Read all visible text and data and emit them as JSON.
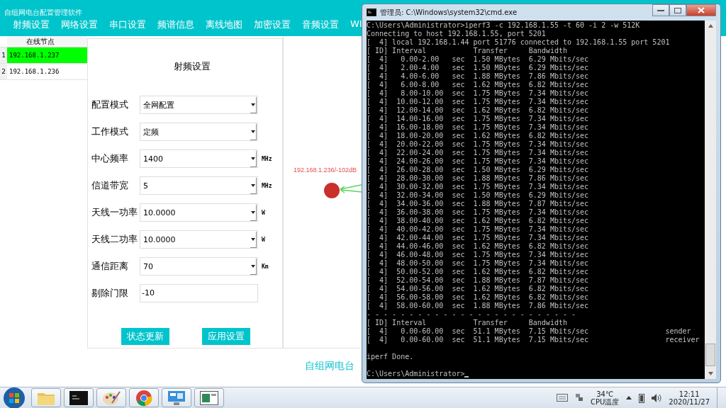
{
  "app": {
    "title": "自组网电台配置管理软件",
    "nav": [
      "射频设置",
      "网络设置",
      "串口设置",
      "频谱信息",
      "离线地图",
      "加密设置",
      "音频设置",
      "WI"
    ]
  },
  "nodes": {
    "header": "在线节点",
    "rows": [
      {
        "index": "1",
        "address": "192.168.1.237",
        "selected": true
      },
      {
        "index": "2",
        "address": "192.168.1.236",
        "selected": false
      }
    ]
  },
  "rf_panel": {
    "title": "射频设置",
    "fields": [
      {
        "label": "配置模式",
        "value": "全网配置",
        "kind": "select"
      },
      {
        "label": "工作模式",
        "value": "定频",
        "kind": "select"
      },
      {
        "label": "中心频率",
        "value": "1400",
        "kind": "select",
        "unit": "MHz"
      },
      {
        "label": "信道带宽",
        "value": "5",
        "kind": "select",
        "unit": "MHz"
      },
      {
        "label": "天线一功率",
        "value": "10.0000",
        "kind": "select",
        "unit": "W"
      },
      {
        "label": "天线二功率",
        "value": "10.0000",
        "kind": "select",
        "unit": "W"
      },
      {
        "label": "通信距离",
        "value": "70",
        "kind": "select",
        "unit": "Km"
      },
      {
        "label": "剔除门限",
        "value": "-10",
        "kind": "input"
      }
    ],
    "buttons": [
      "状态更新",
      "应用设置"
    ]
  },
  "map": {
    "node_label": "192.168.1.236/-102dB"
  },
  "footer_title": "自组网电台",
  "terminal": {
    "title": "管理员: C:\\Windows\\system32\\cmd.exe",
    "lines": [
      {
        "text": "C:\\Users\\Administrator>iperf3 -c 192.168.1.55 -t 60 -i 2 -w 512K"
      },
      {
        "text": "Connecting to host 192.168.1.55, port 5201"
      },
      {
        "text": "[  4] local 192.168.1.44 port 51776 connected to 192.168.1.55 port 5201"
      },
      {
        "text": "[ ID] Interval           Transfer     Bandwidth"
      },
      {
        "text": "[  4]   0.00-2.00   sec  1.50 MBytes  6.29 Mbits/sec"
      },
      {
        "text": "[  4]   2.00-4.00   sec  1.50 MBytes  6.29 Mbits/sec"
      },
      {
        "text": "[  4]   4.00-6.00   sec  1.88 MBytes  7.86 Mbits/sec"
      },
      {
        "text": "[  4]   6.00-8.00   sec  1.62 MBytes  6.82 Mbits/sec"
      },
      {
        "text": "[  4]   8.00-10.00  sec  1.75 MBytes  7.34 Mbits/sec"
      },
      {
        "text": "[  4]  10.00-12.00  sec  1.75 MBytes  7.34 Mbits/sec"
      },
      {
        "text": "[  4]  12.00-14.00  sec  1.62 MBytes  6.82 Mbits/sec"
      },
      {
        "text": "[  4]  14.00-16.00  sec  1.75 MBytes  7.34 Mbits/sec"
      },
      {
        "text": "[  4]  16.00-18.00  sec  1.75 MBytes  7.34 Mbits/sec"
      },
      {
        "text": "[  4]  18.00-20.00  sec  1.62 MBytes  6.82 Mbits/sec"
      },
      {
        "text": "[  4]  20.00-22.00  sec  1.75 MBytes  7.34 Mbits/sec"
      },
      {
        "text": "[  4]  22.00-24.00  sec  1.75 MBytes  7.34 Mbits/sec"
      },
      {
        "text": "[  4]  24.00-26.00  sec  1.75 MBytes  7.34 Mbits/sec"
      },
      {
        "text": "[  4]  26.00-28.00  sec  1.50 MBytes  6.29 Mbits/sec"
      },
      {
        "text": "[  4]  28.00-30.00  sec  1.88 MBytes  7.86 Mbits/sec"
      },
      {
        "text": "[  4]  30.00-32.00  sec  1.75 MBytes  7.34 Mbits/sec"
      },
      {
        "text": "[  4]  32.00-34.00  sec  1.50 MBytes  6.29 Mbits/sec"
      },
      {
        "text": "[  4]  34.00-36.00  sec  1.88 MBytes  7.87 Mbits/sec"
      },
      {
        "text": "[  4]  36.00-38.00  sec  1.75 MBytes  7.34 Mbits/sec"
      },
      {
        "text": "[  4]  38.00-40.00  sec  1.62 MBytes  6.82 Mbits/sec"
      },
      {
        "text": "[  4]  40.00-42.00  sec  1.75 MBytes  7.34 Mbits/sec"
      },
      {
        "text": "[  4]  42.00-44.00  sec  1.75 MBytes  7.34 Mbits/sec"
      },
      {
        "text": "[  4]  44.00-46.00  sec  1.62 MBytes  6.82 Mbits/sec"
      },
      {
        "text": "[  4]  46.00-48.00  sec  1.75 MBytes  7.34 Mbits/sec"
      },
      {
        "text": "[  4]  48.00-50.00  sec  1.75 MBytes  7.34 Mbits/sec"
      },
      {
        "text": "[  4]  50.00-52.00  sec  1.62 MBytes  6.82 Mbits/sec"
      },
      {
        "text": "[  4]  52.00-54.00  sec  1.88 MBytes  7.87 Mbits/sec"
      },
      {
        "text": "[  4]  54.00-56.00  sec  1.62 MBytes  6.82 Mbits/sec"
      },
      {
        "text": "[  4]  56.00-58.00  sec  1.62 MBytes  6.82 Mbits/sec"
      },
      {
        "text": "[  4]  58.00-60.00  sec  1.88 MBytes  7.86 Mbits/sec"
      },
      {
        "text": "- - - - - - - - - - - - - - - - - - - - - - - - -"
      },
      {
        "text": "[ ID] Interval           Transfer     Bandwidth"
      },
      {
        "text": "[  4]   0.00-60.00  sec  51.1 MBytes  7.15 Mbits/sec                  sender"
      },
      {
        "text": "[  4]   0.00-60.00  sec  51.1 MBytes  7.15 Mbits/sec                  receiver"
      },
      {
        "text": "iperf Done.",
        "gap_before": true
      },
      {
        "text": "C:\\Users\\Administrator>",
        "gap_before": true,
        "cursor": true
      }
    ]
  },
  "taskbar": {
    "temperature": "34℃",
    "temperature_label": "CPU温度",
    "time": "12:11",
    "date": "2020/11/27"
  }
}
